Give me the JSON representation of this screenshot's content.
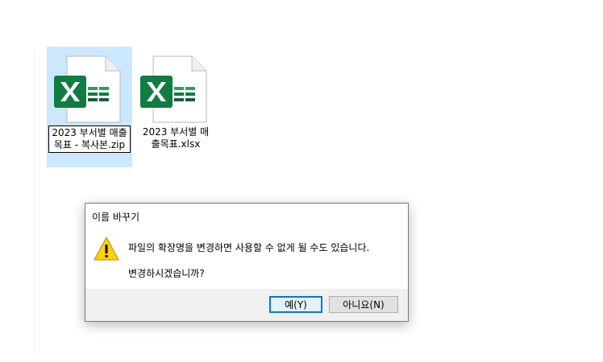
{
  "files": [
    {
      "name_line1": "2023 부서별 매출",
      "name_line2": "목표 - 복사본.zip",
      "selected": true,
      "icon": "excel-file-icon"
    },
    {
      "name_line1": "2023 부서별 매",
      "name_line2": "출목표.xlsx",
      "selected": false,
      "icon": "excel-file-icon"
    }
  ],
  "dialog": {
    "title": "이름 바꾸기",
    "message": "파일의 확장명을 변경하면 사용할 수 없게 될 수도 있습니다.",
    "question": "변경하시겠습니까?",
    "yes_label": "예(Y)",
    "no_label": "아니요(N)",
    "icon": "warning-icon"
  },
  "colors": {
    "selection": "#cce8ff",
    "excel_green": "#107c41",
    "default_button_border": "#0078d7",
    "warning_yellow": "#ffd400"
  }
}
